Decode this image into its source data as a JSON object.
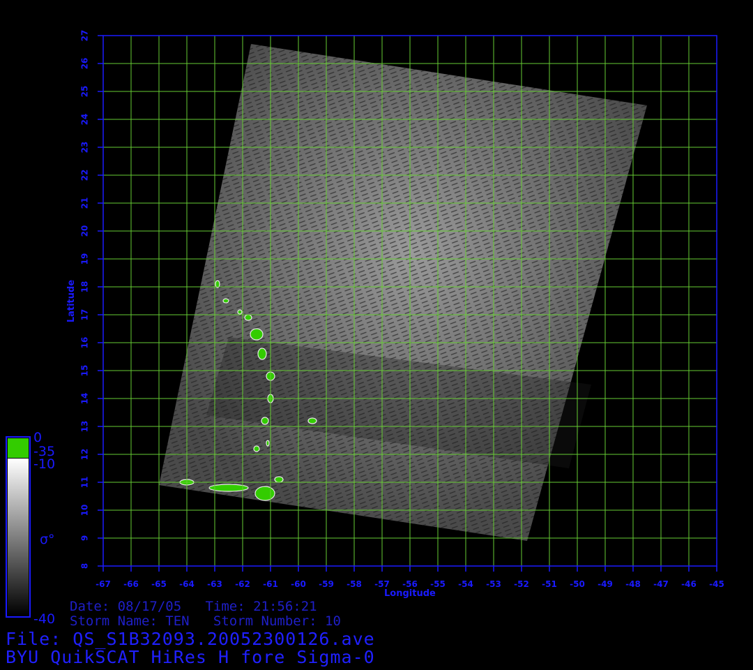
{
  "map": {
    "lon_min": -67,
    "lon_max": -45,
    "lat_min": 8,
    "lat_max": 27,
    "lon_ticks": [
      "-67",
      "-66",
      "-65",
      "-64",
      "-63",
      "-62",
      "-61",
      "-60",
      "-59",
      "-58",
      "-57",
      "-56",
      "-55",
      "-54",
      "-53",
      "-52",
      "-51",
      "-50",
      "-49",
      "-48",
      "-47",
      "-46",
      "-45"
    ],
    "lat_ticks": [
      "8",
      "9",
      "10",
      "11",
      "12",
      "13",
      "14",
      "15",
      "16",
      "17",
      "18",
      "19",
      "20",
      "21",
      "22",
      "23",
      "24",
      "25",
      "26",
      "27"
    ],
    "xlabel": "Longitude",
    "ylabel": "Latitude",
    "swath_corners_lonlat": [
      [
        -61.7,
        26.7
      ],
      [
        -47.5,
        24.5
      ],
      [
        -51.8,
        8.9
      ],
      [
        -65.0,
        10.9
      ]
    ],
    "colors": {
      "grid": "#66cc33",
      "axes": "#1a1aff",
      "land": "#33cc00",
      "background": "#000000"
    }
  },
  "colorbar": {
    "top_label": "0",
    "land_label": "-35",
    "upper_label": "-10",
    "bottom_label": "-40",
    "symbol": "σ°"
  },
  "info": {
    "date_line": "Date: 08/17/05   Time: 21:56:21",
    "storm_line": "Storm Name: TEN   Storm Number: 10",
    "file_line": "File: QS_S1B32093.20052300126.ave",
    "product_line": "BYU QuikSCAT HiRes H fore Sigma-0"
  }
}
